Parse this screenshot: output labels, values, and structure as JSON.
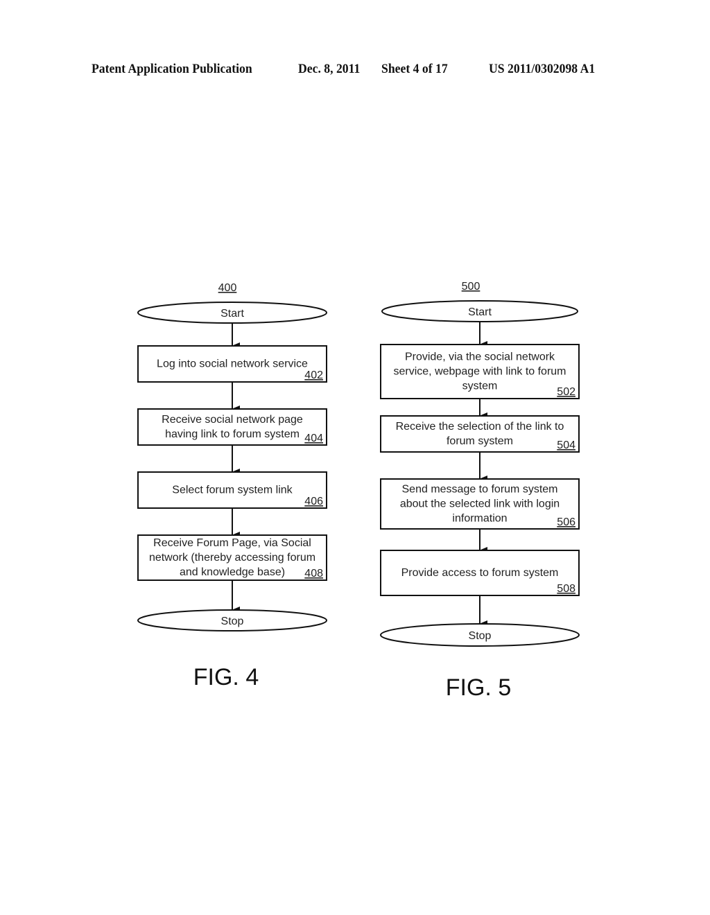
{
  "header": {
    "publication": "Patent Application Publication",
    "date": "Dec. 8, 2011",
    "sheet": "Sheet 4 of 17",
    "number": "US 2011/0302098 A1"
  },
  "figures": [
    {
      "id": "fig4",
      "ref": "400",
      "caption": "FIG. 4",
      "start_label": "Start",
      "stop_label": "Stop",
      "steps": [
        {
          "ref": "402",
          "lines": [
            "Log into social network service"
          ]
        },
        {
          "ref": "404",
          "lines": [
            "Receive social network page",
            "having link to forum system"
          ]
        },
        {
          "ref": "406",
          "lines": [
            "Select forum system  link"
          ]
        },
        {
          "ref": "408",
          "lines": [
            "Receive Forum Page, via Social",
            "network (thereby accessing forum",
            "and knowledge base)"
          ]
        }
      ]
    },
    {
      "id": "fig5",
      "ref": "500",
      "caption": "FIG. 5",
      "start_label": "Start",
      "stop_label": "Stop",
      "steps": [
        {
          "ref": "502",
          "lines": [
            "Provide, via the social network",
            "service, webpage with link to forum",
            "system"
          ]
        },
        {
          "ref": "504",
          "lines": [
            "Receive the selection of the link to",
            "forum system"
          ]
        },
        {
          "ref": "506",
          "lines": [
            "Send message to forum system",
            "about the selected link with login",
            "information"
          ]
        },
        {
          "ref": "508",
          "lines": [
            "Provide access to forum system"
          ]
        }
      ]
    }
  ]
}
